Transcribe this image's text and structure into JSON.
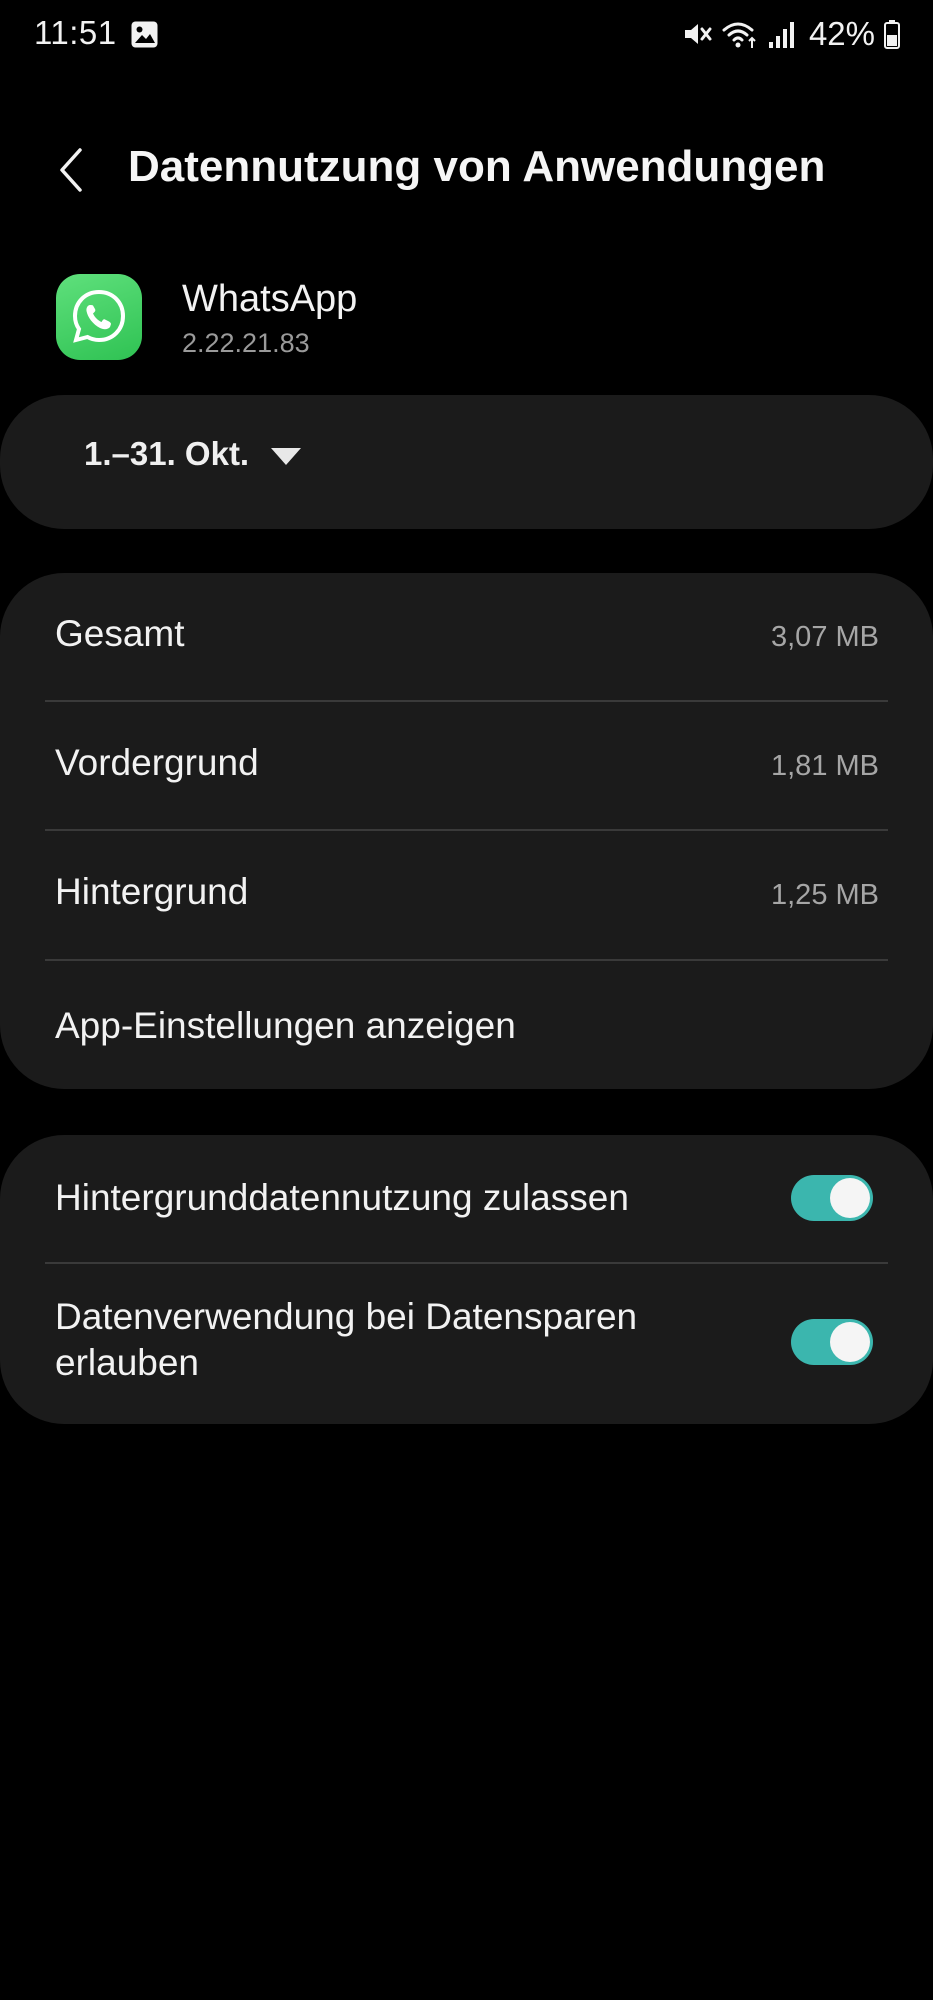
{
  "status_bar": {
    "time": "11:51",
    "battery": "42%",
    "icons": [
      "gallery-icon",
      "mute-icon",
      "wifi-icon",
      "signal-icon",
      "battery-icon"
    ]
  },
  "header": {
    "title": "Datennutzung von Anwendungen",
    "back_icon": "chevron-left-icon"
  },
  "app": {
    "name": "WhatsApp",
    "version": "2.22.21.83",
    "icon": "whatsapp-icon",
    "icon_color": "#3fcf62"
  },
  "date_range": {
    "label": "1.–31. Okt.",
    "icon": "dropdown-triangle-icon"
  },
  "usage": {
    "total_label": "Gesamt",
    "total_value": "3,07 MB",
    "foreground_label": "Vordergrund",
    "foreground_value": "1,81 MB",
    "background_label": "Hintergrund",
    "background_value": "1,25 MB",
    "app_settings_label": "App-Einstellungen anzeigen"
  },
  "toggles": {
    "background_data_label": "Hintergrunddatennutzung zulassen",
    "background_data_on": true,
    "data_saver_label": "Datenverwendung bei Datensparen erlauben",
    "data_saver_on": true,
    "accent_color": "#3bb6ae"
  },
  "colors": {
    "background": "#000000",
    "card": "#1b1b1b",
    "secondary_text": "#a6a6a6"
  }
}
